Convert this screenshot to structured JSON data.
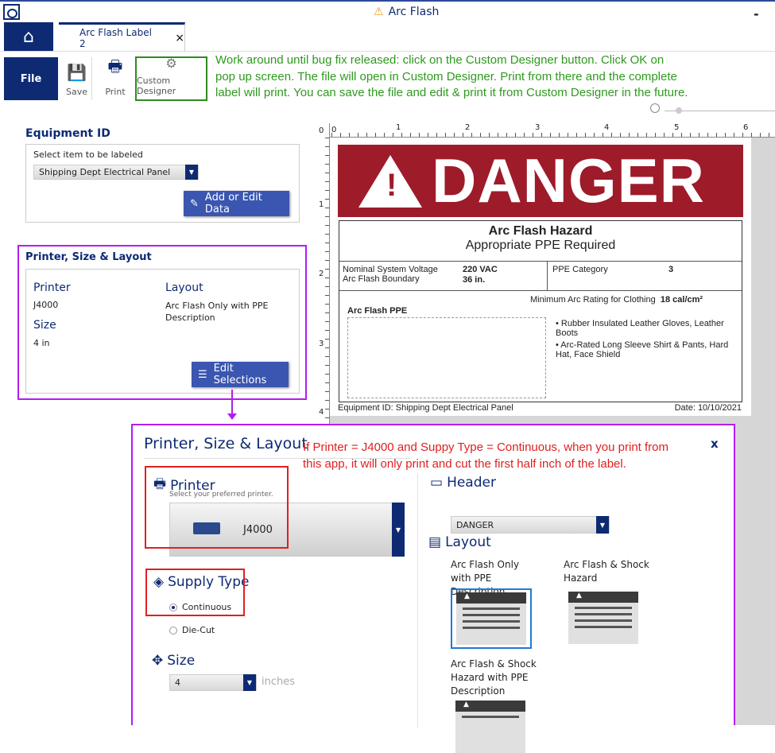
{
  "window": {
    "title": "Arc Flash",
    "minimize": "-"
  },
  "tabs": {
    "active": "Arc Flash Label 2",
    "close": "×"
  },
  "ribbon": {
    "file": "File",
    "save": "Save",
    "print": "Print",
    "custom_designer": "Custom Designer"
  },
  "annotations": {
    "workaround": [
      "Work around until bug fix released: click on the Custom Designer button. Click OK on",
      "pop up screen.  The file will open in Custom Designer.  Print from there and the complete",
      "label will print.  You can save the file and edit & print it from Custom Designer in the future."
    ],
    "bug": [
      "If Printer = J4000 and Suppy Type = Continuous, when you print from",
      "this app, it will only print and cut the first half inch of the label."
    ]
  },
  "equipment": {
    "heading": "Equipment ID",
    "select_label": "Select item to be labeled",
    "selected": "Shipping Dept Electrical Panel",
    "add_edit": "Add or Edit Data"
  },
  "summary": {
    "heading": "Printer, Size & Layout",
    "printer_label": "Printer",
    "printer": "J4000",
    "size_label": "Size",
    "size": "4 in",
    "layout_label": "Layout",
    "layout": "Arc Flash Only with PPE Description",
    "edit": "Edit Selections"
  },
  "ruler": {
    "top": [
      "0",
      "1",
      "2",
      "3",
      "4",
      "5",
      "6"
    ],
    "left": [
      "0",
      "1",
      "2",
      "3",
      "4"
    ]
  },
  "label": {
    "header": "DANGER",
    "title": "Arc Flash Hazard",
    "subtitle": "Appropriate PPE Required",
    "voltage_label": "Nominal System Voltage",
    "voltage": "220 VAC",
    "boundary_label": "Arc Flash Boundary",
    "boundary": "36 in.",
    "ppe_cat_label": "PPE Category",
    "ppe_cat": "3",
    "min_rating_label": "Minimum Arc Rating for Clothing",
    "min_rating": "18 cal/cm²",
    "ppe_heading": "Arc Flash PPE",
    "ppe_items": [
      "• Rubber Insulated Leather Gloves, Leather Boots",
      "• Arc-Rated Long Sleeve Shirt & Pants, Hard Hat, Face Shield"
    ],
    "equipment_id": "Equipment ID: Shipping Dept Electrical Panel",
    "date": "Date: 10/10/2021",
    "header_color": "#9e1b2a"
  },
  "dialog": {
    "title": "Printer, Size & Layout",
    "close": "x",
    "printer_heading": "Printer",
    "printer_hint": "Select your preferred printer.",
    "printer": "J4000",
    "supply_heading": "Supply Type",
    "supply_options": [
      "Continuous",
      "Die-Cut"
    ],
    "supply_selected": "Continuous",
    "size_heading": "Size",
    "size": "4",
    "size_unit": "inches",
    "header_heading": "Header",
    "header": "DANGER",
    "layout_heading": "Layout",
    "layouts": [
      "Arc Flash Only with PPE Description",
      "Arc Flash & Shock Hazard",
      "Arc Flash & Shock Hazard with PPE Description"
    ],
    "layout_selected": "Arc Flash Only with PPE Description"
  },
  "colors": {
    "navy": "#0d2a73",
    "button": "#3a56b0",
    "annotation_green": "#2e9a1e",
    "annotation_red": "#e02020",
    "annotation_purple": "#b11ef0"
  }
}
